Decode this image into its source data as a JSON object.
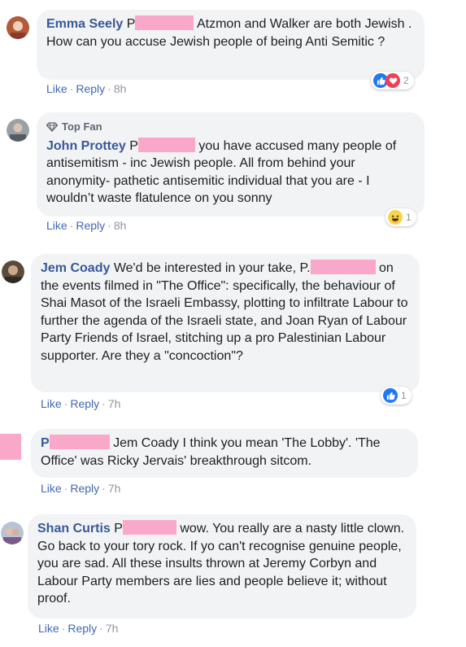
{
  "comments": [
    {
      "name": "Emma Seely",
      "redact_prefix": "P",
      "text": "Atzmon and Walker are both Jewish . How can you accuse Jewish people of being Anti Semitic ?",
      "actions": {
        "like": "Like",
        "reply": "Reply",
        "time": "8h"
      },
      "reactions": {
        "icons": [
          "like-icon",
          "love-icon"
        ],
        "count": "2"
      }
    },
    {
      "badge": "Top Fan",
      "name": "John Prottey",
      "redact_prefix": "P",
      "text": "you have accused many people of antisemitism - inc Jewish people. All from behind your anonymity- pathetic antisemitic individual that you are - I wouldn’t waste flatulence on you sonny",
      "actions": {
        "like": "Like",
        "reply": "Reply",
        "time": "8h"
      },
      "reactions": {
        "icons": [
          "haha-icon"
        ],
        "count": "1"
      }
    },
    {
      "name": "Jem Coady",
      "text_before": "We'd be interested in your take, P.",
      "text": "on the events filmed in \"The Office\": specifically, the behaviour of Shai Masot of the Israeli Embassy, plotting to infiltrate Labour to further the agenda of the Israeli state, and Joan Ryan of Labour Party Friends of Israel, stitching up a pro Palestinian Labour supporter. Are they a \"concoction\"?",
      "actions": {
        "like": "Like",
        "reply": "Reply",
        "time": "7h"
      },
      "reactions": {
        "icons": [
          "like-icon"
        ],
        "count": "1"
      }
    },
    {
      "name": "P",
      "text": "Jem Coady I think you mean 'The Lobby'. 'The Office' was Ricky Jervais' breakthrough sitcom.",
      "actions": {
        "like": "Like",
        "reply": "Reply",
        "time": "7h"
      }
    },
    {
      "name": "Shan Curtis",
      "redact_prefix": "P",
      "text": "wow. You really are a nasty little clown. Go back to your tory rock. If yo can't recognise genuine people, you are sad. All these insults thrown at Jeremy Corbyn and Labour Party members are lies and people believe it; without proof.",
      "actions": {
        "like": "Like",
        "reply": "Reply",
        "time": "7h"
      }
    }
  ],
  "colors": {
    "name": "#385898",
    "bubble": "#f2f3f5",
    "redaction": "#f9a8c9",
    "link": "#4267b2",
    "meta": "#90949c"
  }
}
